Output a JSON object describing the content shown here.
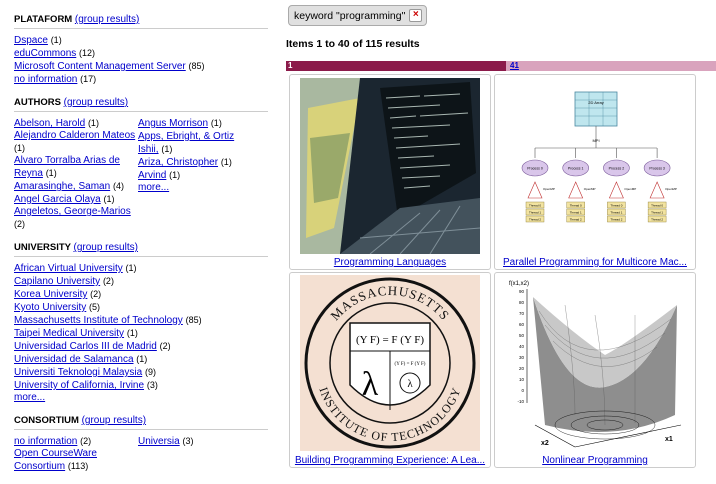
{
  "sidebar": {
    "plataform": {
      "heading": "PLATAFORM",
      "group_link": "(group results)",
      "items": [
        {
          "label": "Dspace",
          "count": "(1)"
        },
        {
          "label": "eduCommons",
          "count": "(12)"
        },
        {
          "label": "Microsoft Content Management Server",
          "count": "(85)"
        },
        {
          "label": "no information",
          "count": "(17)"
        }
      ]
    },
    "authors": {
      "heading": "AUTHORS",
      "group_link": "(group results)",
      "col1": [
        {
          "label": "Abelson, Harold",
          "count": "(1)"
        },
        {
          "label": "Alejandro Calderon Mateos",
          "count": "(1)"
        },
        {
          "label": "Alvaro Torralba Arias de Reyna",
          "count": "(1)"
        },
        {
          "label": "Amarasinghe, Saman",
          "count": "(4)"
        },
        {
          "label": "Angel Garcia Olaya",
          "count": "(1)"
        },
        {
          "label": "Angeletos, George-Marios",
          "count": "(2)"
        }
      ],
      "col2": [
        {
          "label": "Angus Morrison",
          "count": "(1)"
        },
        {
          "label": "Apps, Ebright, & Ortiz",
          "count": ""
        },
        {
          "label": "Ishii,",
          "count": "(1)"
        },
        {
          "label": "Ariza, Christopher",
          "count": "(1)"
        },
        {
          "label": "Arvind",
          "count": "(1)"
        }
      ],
      "more": "more..."
    },
    "university": {
      "heading": "UNIVERSITY",
      "group_link": "(group results)",
      "items": [
        {
          "label": "African Virtual University",
          "count": "(1)"
        },
        {
          "label": "Capilano University",
          "count": "(2)"
        },
        {
          "label": "Korea University",
          "count": "(2)"
        },
        {
          "label": "Kyoto University",
          "count": "(5)"
        },
        {
          "label": "Massachusetts Institute of Technology",
          "count": "(85)"
        },
        {
          "label": "Taipei Medical University",
          "count": "(1)"
        },
        {
          "label": "Universidad Carlos III de Madrid",
          "count": "(2)"
        },
        {
          "label": "Universidad de Salamanca",
          "count": "(1)"
        },
        {
          "label": "Universiti Teknologi Malaysia",
          "count": "(9)"
        },
        {
          "label": "University of California, Irvine",
          "count": "(3)"
        }
      ],
      "more": "more..."
    },
    "consortium": {
      "heading": "CONSORTIUM",
      "group_link": "(group results)",
      "col1": [
        {
          "label": "no information",
          "count": "(2)"
        },
        {
          "label": "Open CourseWare Consortium",
          "count": "(113)"
        }
      ],
      "col2": [
        {
          "label": "Universia",
          "count": "(3)"
        }
      ]
    }
  },
  "filter_chip": {
    "label": "keyword \"programming\"",
    "remove_icon": "close-icon",
    "remove_glyph": "×"
  },
  "results": {
    "summary": "Items 1 to 40 of 115 results",
    "pager": {
      "current": "1",
      "next": "41"
    },
    "cards": [
      {
        "title": "Programming Languages"
      },
      {
        "title": "Parallel Programming for Multicore Mac..."
      },
      {
        "title": "Building Programming Experience: A Lea..."
      },
      {
        "title": "Nonlinear Programming"
      }
    ],
    "diagram": {
      "array_label": "2D Array",
      "mpi_label": "MPI",
      "openmp_label": "OpenMP",
      "processes": [
        "Process 0",
        "Process 1",
        "Process 2",
        "Process 3"
      ],
      "threads": [
        "Thread 0",
        "Thread 1",
        "Thread 2"
      ]
    },
    "seal": {
      "top_text": "MASSACHUSETTS",
      "bottom_text": "INSTITUTE OF TECHNOLOGY",
      "formula": "(Y F) = F (Y F)",
      "small_formula": "(Y F) = F (Y F)",
      "lambda": "λ"
    },
    "plot": {
      "zlabel": "f(x1,x2)",
      "x1": "x1",
      "x2": "x2",
      "zticks": [
        "90",
        "80",
        "70",
        "60",
        "50",
        "40",
        "30",
        "20",
        "10",
        "0",
        "-10"
      ]
    }
  }
}
